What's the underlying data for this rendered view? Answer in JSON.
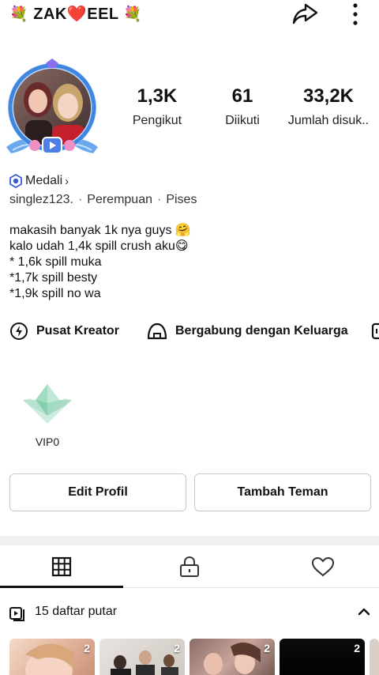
{
  "header": {
    "title": "ZAK❤️EEL",
    "title_decor_emoji": "💐",
    "share_icon": "share-arrow-icon",
    "more_icon": "more-vertical-icon"
  },
  "profile": {
    "stats": [
      {
        "value": "1,3K",
        "label": "Pengikut"
      },
      {
        "value": "61",
        "label": "Diikuti"
      },
      {
        "value": "33,2K",
        "label": "Jumlah disuk.."
      }
    ],
    "medal_label": "Medali",
    "username": "singlez123.",
    "gender": "Perempuan",
    "zodiac": "Pises",
    "bio": [
      "makasih banyak 1k nya guys 🤗",
      "kalo udah 1,4k spill  crush aku😋",
      "* 1,6k spill muka",
      "*1,7k spill besty",
      "*1,9k spill no wa"
    ]
  },
  "links": [
    {
      "label": "Pusat Kreator",
      "icon": "creator-center-icon"
    },
    {
      "label": "Bergabung dengan Keluarga",
      "icon": "family-house-icon"
    }
  ],
  "vip": {
    "label": "VIP0"
  },
  "actions": {
    "edit_label": "Edit Profil",
    "add_friend_label": "Tambah Teman"
  },
  "tabs": [
    {
      "name": "videos",
      "icon": "grid-icon",
      "active": true
    },
    {
      "name": "private",
      "icon": "lock-icon",
      "active": false
    },
    {
      "name": "liked",
      "icon": "heart-icon",
      "active": false
    }
  ],
  "playlists": {
    "header_label": "15 daftar putar",
    "items": [
      {
        "count": "2"
      },
      {
        "count": "2"
      },
      {
        "count": "2"
      },
      {
        "count": "2"
      }
    ]
  },
  "colors": {
    "text": "#111111",
    "border": "#c8c8c8",
    "separator": "#f1f1f1",
    "avatar_ring": "#4a8fe0",
    "heart": "#e0242b",
    "medal_blue": "#3b5bd6",
    "vip_green": "#9fdcc0"
  }
}
